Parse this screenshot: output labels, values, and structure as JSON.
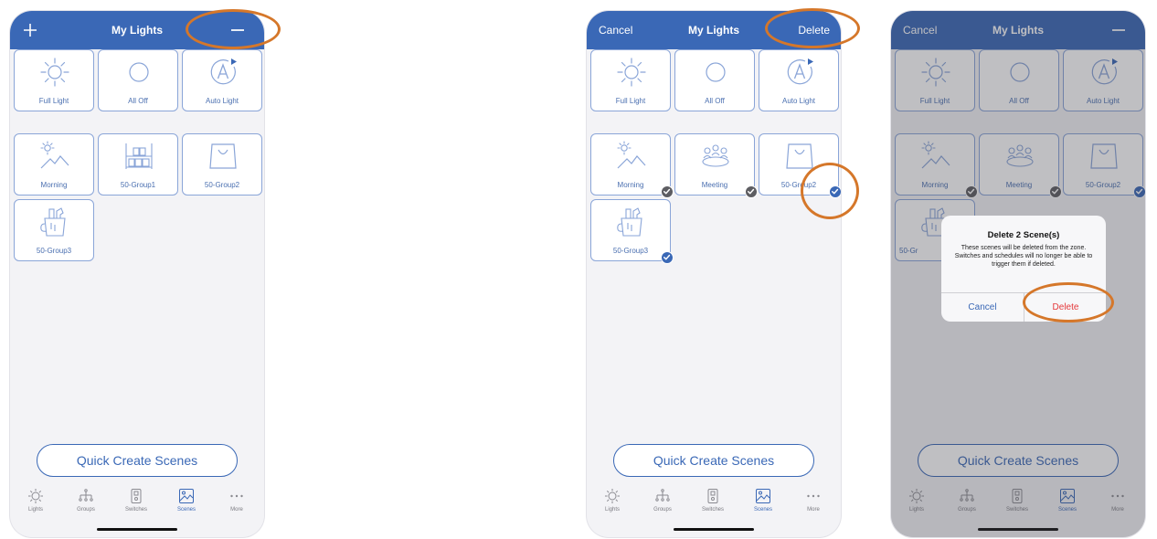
{
  "colors": {
    "primary": "#3a68b6",
    "tile_border": "#8aa5d8",
    "destructive": "#e5393b",
    "highlight": "#d5772a",
    "check_gray": "#5d5d62"
  },
  "screen1": {
    "title": "My Lights",
    "add_icon": "plus-icon",
    "remove_icon": "minus-icon",
    "tiles": [
      "Full Light",
      "All Off",
      "Auto Light",
      "Morning",
      "50-Group1",
      "50-Group2",
      "50-Group3"
    ],
    "quick_create": "Quick Create Scenes",
    "tabs": [
      "Lights",
      "Groups",
      "Switches",
      "Scenes",
      "More"
    ]
  },
  "screen2": {
    "cancel": "Cancel",
    "title": "My Lights",
    "delete": "Delete",
    "tiles": [
      "Full Light",
      "All Off",
      "Auto Light",
      "Morning",
      "Meeting",
      "50-Group2",
      "50-Group3"
    ],
    "quick_create": "Quick Create Scenes",
    "tabs": [
      "Lights",
      "Groups",
      "Switches",
      "Scenes",
      "More"
    ]
  },
  "screen3": {
    "cancel": "Cancel",
    "title": "My Lights",
    "remove_icon": "minus-icon",
    "tiles": [
      "Full Light",
      "All Off",
      "Auto Light",
      "Morning",
      "Meeting",
      "50-Group2",
      "50-Gr"
    ],
    "quick_create": "Quick Create Scenes",
    "tabs": [
      "Lights",
      "Groups",
      "Switches",
      "Scenes",
      "More"
    ],
    "dialog": {
      "title": "Delete 2 Scene(s)",
      "message": "These scenes will be deleted from the zone. Switches and schedules will no longer be able to trigger them if deleted.",
      "cancel": "Cancel",
      "delete": "Delete"
    }
  }
}
